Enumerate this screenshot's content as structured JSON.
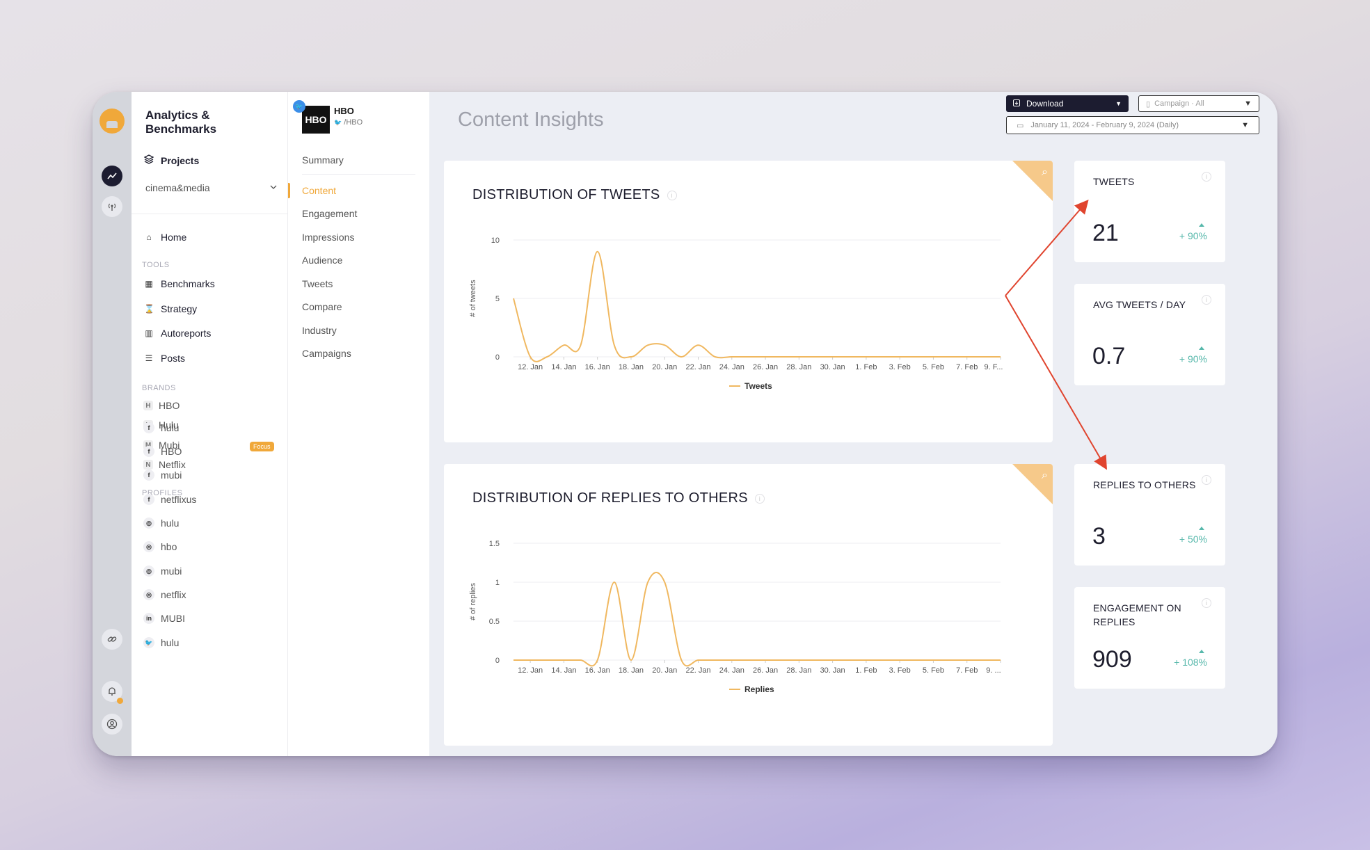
{
  "brand": {
    "title": "Analytics & Benchmarks"
  },
  "sidebar": {
    "projects_label": "Projects",
    "project_select": "cinema&media",
    "home": "Home",
    "tools_heading": "TOOLS",
    "tools": [
      "Benchmarks",
      "Strategy",
      "Autoreports",
      "Posts"
    ],
    "brands_heading": "BRANDS",
    "brands": [
      {
        "letter": "H",
        "name": "HBO"
      },
      {
        "letter": "H",
        "name": "Hulu"
      },
      {
        "letter": "M",
        "name": "Mubi",
        "badge": "Focus"
      },
      {
        "letter": "N",
        "name": "Netflix"
      }
    ],
    "profiles_heading": "PROFILES",
    "profiles": [
      {
        "network": "f",
        "name": "hulu"
      },
      {
        "network": "f",
        "name": "HBO"
      },
      {
        "network": "f",
        "name": "mubi"
      },
      {
        "network": "f",
        "name": "netflixus"
      },
      {
        "network": "◎",
        "name": "hulu"
      },
      {
        "network": "◎",
        "name": "hbo"
      },
      {
        "network": "◎",
        "name": "mubi"
      },
      {
        "network": "◎",
        "name": "netflix"
      },
      {
        "network": "in",
        "name": "MUBI"
      },
      {
        "network": "🐦",
        "name": "hulu"
      }
    ]
  },
  "profile_header": {
    "logo_text": "HBO",
    "name": "HBO",
    "handle": "/HBO"
  },
  "submenu": {
    "items": [
      "Summary",
      "Content",
      "Engagement",
      "Impressions",
      "Audience",
      "Tweets",
      "Compare",
      "Industry",
      "Campaigns"
    ],
    "active": "Content"
  },
  "header": {
    "page_title": "Content Insights",
    "download_label": "Download",
    "campaign_select": "Campaign · All",
    "date_range": "January 11, 2024 - February 9, 2024 (Daily)"
  },
  "kpis": [
    {
      "title": "TWEETS",
      "value": "21",
      "change": "+ 90%"
    },
    {
      "title": "AVG TWEETS / DAY",
      "value": "0.7",
      "change": "+ 90%"
    },
    {
      "title": "REPLIES TO OTHERS",
      "value": "3",
      "change": "+ 50%"
    },
    {
      "title": "ENGAGEMENT ON REPLIES",
      "value": "909",
      "change": "+ 108%"
    }
  ],
  "colors": {
    "accent": "#f0a83a",
    "line": "#f0b860",
    "positive": "#57b8ab",
    "annotation": "#e0442e",
    "dark": "#1c1c30"
  },
  "chart_data": [
    {
      "type": "line",
      "title": "DISTRIBUTION OF TWEETS",
      "ylabel": "# of tweets",
      "xlabel": "",
      "ylim": [
        0,
        10
      ],
      "yticks": [
        0,
        5,
        10
      ],
      "x_tick_labels": [
        "12. Jan",
        "14. Jan",
        "16. Jan",
        "18. Jan",
        "20. Jan",
        "22. Jan",
        "24. Jan",
        "26. Jan",
        "28. Jan",
        "30. Jan",
        "1. Feb",
        "3. Feb",
        "5. Feb",
        "7. Feb",
        "9. F..."
      ],
      "x": [
        "11. Jan",
        "12. Jan",
        "13. Jan",
        "14. Jan",
        "15. Jan",
        "16. Jan",
        "17. Jan",
        "18. Jan",
        "19. Jan",
        "20. Jan",
        "21. Jan",
        "22. Jan",
        "23. Jan",
        "24. Jan",
        "25. Jan",
        "26. Jan",
        "27. Jan",
        "28. Jan",
        "29. Jan",
        "30. Jan",
        "31. Jan",
        "1. Feb",
        "2. Feb",
        "3. Feb",
        "4. Feb",
        "5. Feb",
        "6. Feb",
        "7. Feb",
        "8. Feb",
        "9. Feb"
      ],
      "series": [
        {
          "name": "Tweets",
          "values": [
            5,
            0,
            0,
            1,
            1,
            9,
            1,
            0,
            1,
            1,
            0,
            1,
            0,
            0,
            0,
            0,
            0,
            0,
            0,
            0,
            0,
            0,
            0,
            0,
            0,
            0,
            0,
            0,
            0,
            0
          ]
        }
      ],
      "grid": true,
      "legend": "bottom-center"
    },
    {
      "type": "line",
      "title": "DISTRIBUTION OF REPLIES TO OTHERS",
      "ylabel": "# of replies",
      "xlabel": "",
      "ylim": [
        0,
        1.5
      ],
      "yticks": [
        0,
        0.5,
        1,
        1.5
      ],
      "x_tick_labels": [
        "12. Jan",
        "14. Jan",
        "16. Jan",
        "18. Jan",
        "20. Jan",
        "22. Jan",
        "24. Jan",
        "26. Jan",
        "28. Jan",
        "30. Jan",
        "1. Feb",
        "3. Feb",
        "5. Feb",
        "7. Feb",
        "9. ..."
      ],
      "x": [
        "11. Jan",
        "12. Jan",
        "13. Jan",
        "14. Jan",
        "15. Jan",
        "16. Jan",
        "17. Jan",
        "18. Jan",
        "19. Jan",
        "20. Jan",
        "21. Jan",
        "22. Jan",
        "23. Jan",
        "24. Jan",
        "25. Jan",
        "26. Jan",
        "27. Jan",
        "28. Jan",
        "29. Jan",
        "30. Jan",
        "31. Jan",
        "1. Feb",
        "2. Feb",
        "3. Feb",
        "4. Feb",
        "5. Feb",
        "6. Feb",
        "7. Feb",
        "8. Feb",
        "9. Feb"
      ],
      "series": [
        {
          "name": "Replies",
          "values": [
            0,
            0,
            0,
            0,
            0,
            0,
            1,
            0,
            1,
            1,
            0,
            0,
            0,
            0,
            0,
            0,
            0,
            0,
            0,
            0,
            0,
            0,
            0,
            0,
            0,
            0,
            0,
            0,
            0,
            0
          ]
        }
      ],
      "grid": true,
      "legend": "bottom-center"
    }
  ]
}
